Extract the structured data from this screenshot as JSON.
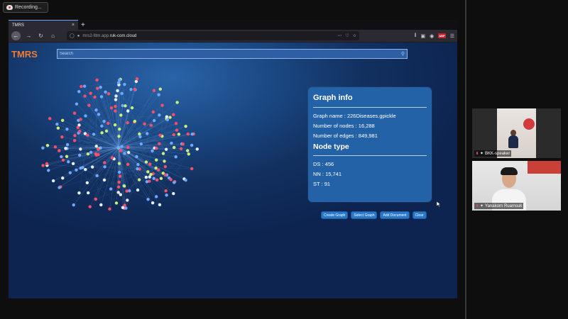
{
  "recording": {
    "label": "Recording..."
  },
  "browser": {
    "tab_title": "TMRS",
    "tab_close": "×",
    "new_tab": "+",
    "url_prefix": "mrs2-fitm.app.",
    "url_domain": "ruk-com.cloud",
    "url_right_icons": [
      "more-icon",
      "pocket-icon",
      "star-icon"
    ],
    "toolbar_icons": [
      "library-icon",
      "sidebar-icon",
      "account-icon",
      "adblock-icon",
      "menu-icon"
    ],
    "adblock_label": "ABP"
  },
  "app": {
    "logo": "TMRS",
    "search": {
      "placeholder": "Search",
      "value": ""
    }
  },
  "graph_info": {
    "title": "Graph info",
    "name": "Graph name : 226Diseases.gpickle",
    "nodes": "Number of nodes : 16,288",
    "edges": "Number of edges : 849,981",
    "node_type_title": "Node type",
    "ds": "DS : 456",
    "nn": "NN : 15,741",
    "st": "ST : 91"
  },
  "actions": {
    "create": "Create Graph",
    "select": "Select Graph",
    "add": "Add Document",
    "clear": "Clear"
  },
  "graph_colors": {
    "edge": "#5f93d6",
    "red": "#ff4d6a",
    "blue": "#6fa8ff",
    "green": "#c8f07a",
    "white": "#e8f0ff"
  },
  "participants": [
    {
      "name": "BKK-speaker"
    },
    {
      "name": "Yanakorn Ruamsuk"
    }
  ]
}
